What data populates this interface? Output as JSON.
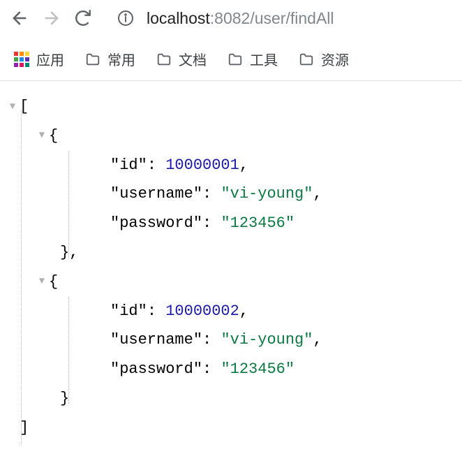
{
  "toolbar": {
    "url_host": "localhost",
    "url_port_path": ":8082/user/findAll"
  },
  "bookmarks": {
    "apps_label": "应用",
    "items": [
      {
        "label": "常用"
      },
      {
        "label": "文档"
      },
      {
        "label": "工具"
      },
      {
        "label": "资源"
      }
    ]
  },
  "json": {
    "records": [
      {
        "id_key": "\"id\"",
        "id_value": "10000001",
        "username_key": "\"username\"",
        "username_value": "\"vi-young\"",
        "password_key": "\"password\"",
        "password_value": "\"123456\""
      },
      {
        "id_key": "\"id\"",
        "id_value": "10000002",
        "username_key": "\"username\"",
        "username_value": "\"vi-young\"",
        "password_key": "\"password\"",
        "password_value": "\"123456\""
      }
    ]
  }
}
